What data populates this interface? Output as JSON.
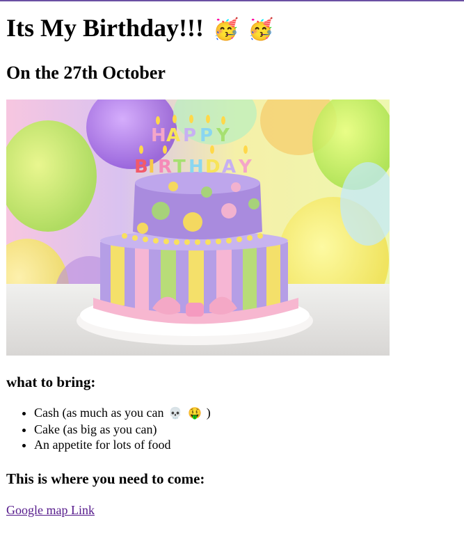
{
  "header": {
    "title": "Its My Birthday!!!",
    "title_emoji_1": "🥳",
    "title_emoji_2": "🥳",
    "subtitle": "On the 27th October"
  },
  "bring": {
    "heading": "what to bring:",
    "items": [
      {
        "text": "Cash (as much as you can",
        "emoji_1": "💀",
        "emoji_2": "🤑",
        "suffix": ")"
      },
      {
        "text": "Cake (as big as you can)"
      },
      {
        "text": "An appetite for lots of food"
      }
    ]
  },
  "location": {
    "heading": "This is where you need to come:",
    "link_text": "Google map Link"
  },
  "image": {
    "icon": "birthday-cake-photo",
    "caption_letters": "HAPPY BIRTHDAY"
  }
}
